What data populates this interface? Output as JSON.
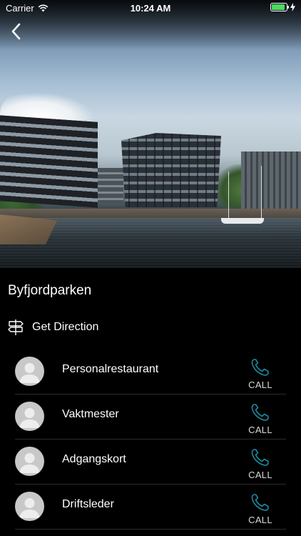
{
  "status_bar": {
    "carrier": "Carrier",
    "time": "10:24 AM",
    "battery_level": 0.9,
    "battery_color": "#4cd964"
  },
  "hero": {
    "back_icon": "chevron-left-icon"
  },
  "place": {
    "title": "Byfjordparken",
    "direction_label": "Get Direction",
    "direction_icon": "signpost-icon"
  },
  "contacts": [
    {
      "name": "Personalrestaurant",
      "call_label": "CALL"
    },
    {
      "name": "Vaktmester",
      "call_label": "CALL"
    },
    {
      "name": "Adgangskort",
      "call_label": "CALL"
    },
    {
      "name": "Driftsleder",
      "call_label": "CALL"
    }
  ],
  "colors": {
    "background": "#000000",
    "phone_icon": "#1b8a9c",
    "divider": "#2c2c2c"
  }
}
